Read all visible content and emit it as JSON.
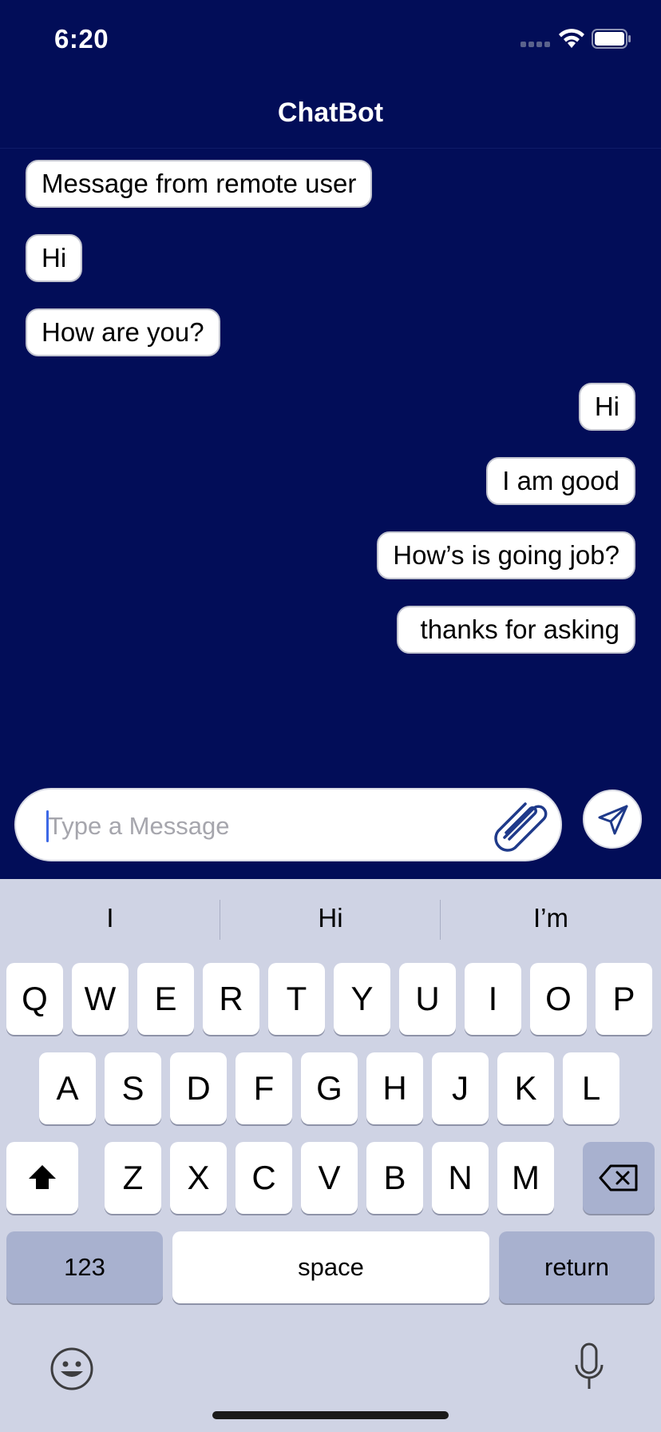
{
  "status": {
    "time": "6:20"
  },
  "nav": {
    "title": "ChatBot"
  },
  "messages": [
    {
      "text": "Message from remote user",
      "side": "left"
    },
    {
      "text": "Hi",
      "side": "left"
    },
    {
      "text": "How are you?",
      "side": "left"
    },
    {
      "text": "Hi",
      "side": "right"
    },
    {
      "text": "I am good",
      "side": "right"
    },
    {
      "text": "How’s is going job?",
      "side": "right"
    },
    {
      "text": "thanks for asking",
      "side": "right"
    }
  ],
  "composer": {
    "placeholder": "Type a Message",
    "value": ""
  },
  "keyboard": {
    "suggestions": [
      "I",
      "Hi",
      "I’m"
    ],
    "row1": [
      "Q",
      "W",
      "E",
      "R",
      "T",
      "Y",
      "U",
      "I",
      "O",
      "P"
    ],
    "row2": [
      "A",
      "S",
      "D",
      "F",
      "G",
      "H",
      "J",
      "K",
      "L"
    ],
    "row3": [
      "Z",
      "X",
      "C",
      "V",
      "B",
      "N",
      "M"
    ],
    "numbers_label": "123",
    "space_label": "space",
    "return_label": "return"
  },
  "icons": {
    "wifi": "wifi-icon",
    "battery": "battery-icon",
    "attach": "paperclip-icon",
    "send": "send-icon",
    "shift": "shift-icon",
    "delete": "backspace-icon",
    "emoji": "emoji-icon",
    "mic": "microphone-icon"
  },
  "colors": {
    "background": "#020d58",
    "bubble": "#ffffff",
    "keyboard": "#cfd3e4",
    "accent": "#1f3a8a"
  }
}
